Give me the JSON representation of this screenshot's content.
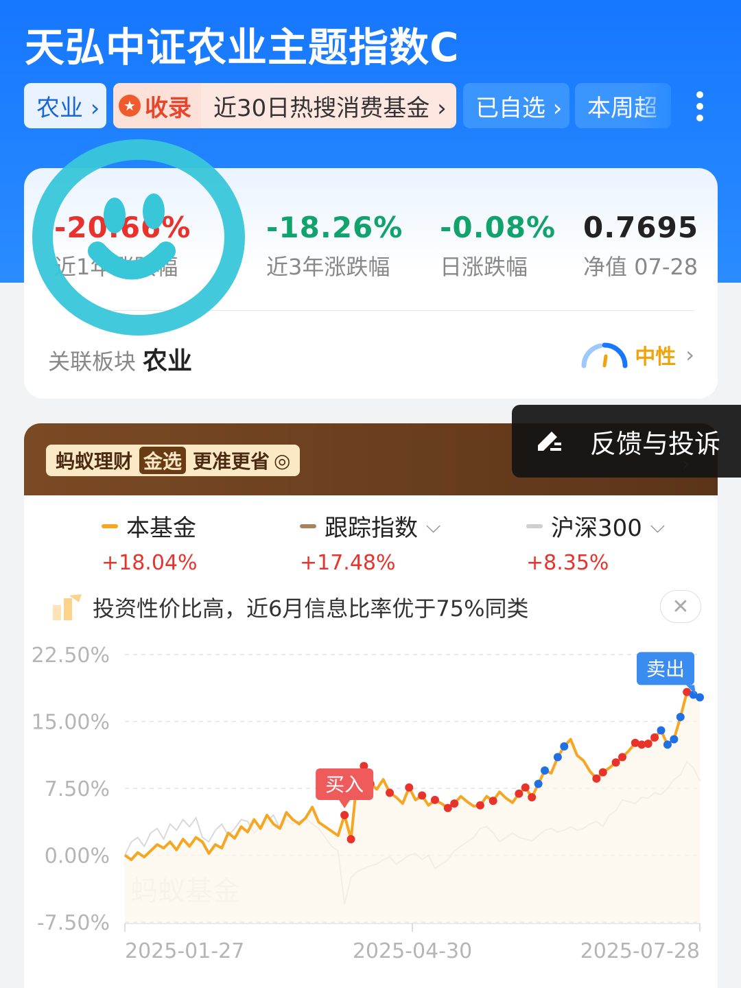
{
  "header": {
    "title": "天弘中证农业主题指数C",
    "chips": {
      "agriculture": "农业 ›",
      "record_badge": "收录",
      "record_text": "近30日热搜消费基金 ›",
      "watchlist": "已自选 ›",
      "weekly": "本周超"
    }
  },
  "summary": {
    "stats": [
      {
        "value": "-20.66%",
        "label": "近1年涨跌幅",
        "color": "#e8322c"
      },
      {
        "value": "-18.26%",
        "label": "近3年涨跌幅",
        "color": "#11a36b"
      },
      {
        "value": "-0.08%",
        "label": "日涨跌幅",
        "color": "#11a36b"
      },
      {
        "value": "0.7695",
        "label": "净值 07-28",
        "color": "#222222"
      }
    ],
    "related_label": "关联板块",
    "related_value": "农业",
    "sentiment": "中性"
  },
  "banner": {
    "brand": "蚂蚁理财",
    "badge": "金选",
    "slogan": "更准更省"
  },
  "feedback": {
    "label": "反馈与投诉"
  },
  "legend": [
    {
      "name": "本基金",
      "pct": "+18.04%",
      "color": "#f5a623",
      "has_dropdown": false
    },
    {
      "name": "跟踪指数",
      "pct": "+17.48%",
      "color": "#a8845c",
      "has_dropdown": true
    },
    {
      "name": "沪深300",
      "pct": "+8.35%",
      "color": "#cfcfcf",
      "has_dropdown": true
    }
  ],
  "tip": {
    "text": "投资性价比高，近6月信息比率优于75%同类"
  },
  "chart_data": {
    "type": "line",
    "y_ticks": [
      "22.50%",
      "15.00%",
      "7.50%",
      "0.00%",
      "-7.50%"
    ],
    "ylim": [
      -7.5,
      22.5
    ],
    "x_ticks": [
      "2025-01-27",
      "2025-04-30",
      "2025-07-28"
    ],
    "watermark": "蚂蚁基金",
    "markers": {
      "buy": "买入",
      "sell": "卖出"
    },
    "series": [
      {
        "name": "本基金",
        "color": "#f5a623",
        "values": [
          0.0,
          -0.5,
          0.3,
          -0.2,
          0.5,
          1.2,
          0.8,
          1.5,
          0.6,
          1.8,
          1.0,
          2.0,
          1.5,
          0.2,
          1.2,
          0.8,
          2.5,
          1.9,
          3.2,
          2.6,
          4.0,
          3.0,
          4.5,
          3.5,
          3.0,
          4.8,
          4.0,
          3.5,
          4.2,
          5.4,
          3.7,
          3.2,
          2.7,
          2.2,
          4.5,
          1.8,
          9.0,
          10.0,
          8.0,
          7.4,
          8.5,
          7.0,
          6.5,
          5.8,
          7.6,
          6.2,
          6.7,
          5.6,
          6.2,
          5.8,
          5.3,
          5.8,
          6.6,
          6.0,
          5.5,
          5.6,
          6.6,
          6.1,
          7.1,
          6.4,
          5.9,
          6.9,
          7.6,
          6.5,
          8.0,
          9.5,
          9.2,
          11.0,
          12.2,
          13.0,
          11.2,
          10.6,
          9.4,
          8.6,
          9.3,
          9.8,
          10.4,
          11.0,
          11.7,
          12.6,
          12.4,
          12.5,
          13.2,
          14.0,
          12.4,
          13.0,
          15.5,
          18.3,
          18.0,
          17.7
        ]
      },
      {
        "name": "沪深300",
        "color": "#d9d9d9",
        "values": [
          0.0,
          1.5,
          2.0,
          1.0,
          2.5,
          3.0,
          1.8,
          3.5,
          2.8,
          4.0,
          3.2,
          4.2,
          2.0,
          1.5,
          2.8,
          3.5,
          2.2,
          3.0,
          4.0,
          3.8,
          2.5,
          3.2,
          3.8,
          4.5,
          3.0,
          4.0,
          3.5,
          3.8,
          4.2,
          3.5,
          3.0,
          2.0,
          1.0,
          0.5,
          -5.5,
          -2.5,
          -1.8,
          -1.5,
          -1.2,
          -1.0,
          -0.5,
          -0.2,
          -1.0,
          -0.5,
          0.0,
          0.2,
          -0.5,
          0.0,
          -1.5,
          -1.0,
          -0.5,
          0.5,
          1.0,
          1.5,
          2.0,
          3.0,
          3.2,
          2.5,
          1.5,
          2.0,
          2.5,
          2.0,
          1.8,
          1.6,
          2.2,
          2.8,
          3.0,
          2.6,
          2.8,
          3.2,
          2.8,
          3.0,
          3.5,
          3.8,
          3.2,
          4.5,
          5.0,
          6.2,
          6.0,
          5.8,
          6.5,
          6.4,
          7.0,
          6.8,
          7.5,
          8.5,
          9.0,
          10.5,
          9.8,
          8.35
        ]
      }
    ]
  }
}
